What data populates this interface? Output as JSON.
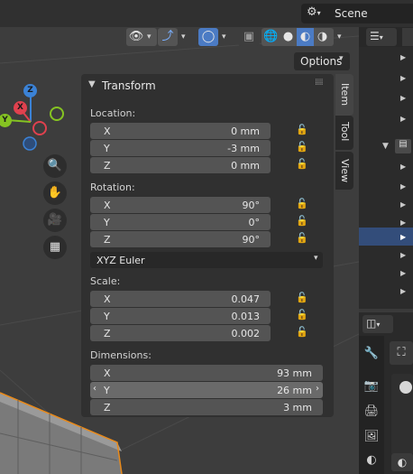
{
  "topbar": {
    "scene_label": "Scene"
  },
  "viewport": {
    "options_label": "Options",
    "gizmo": {
      "x": "X",
      "y": "Y",
      "z": "Z"
    }
  },
  "npanel": {
    "title": "Transform",
    "location": {
      "label": "Location:",
      "rows": [
        {
          "axis": "X",
          "value": "0 mm"
        },
        {
          "axis": "Y",
          "value": "-3 mm"
        },
        {
          "axis": "Z",
          "value": "0 mm"
        }
      ]
    },
    "rotation": {
      "label": "Rotation:",
      "rows": [
        {
          "axis": "X",
          "value": "90°"
        },
        {
          "axis": "Y",
          "value": "0°"
        },
        {
          "axis": "Z",
          "value": "90°"
        }
      ],
      "mode": "XYZ Euler"
    },
    "scale": {
      "label": "Scale:",
      "rows": [
        {
          "axis": "X",
          "value": "0.047"
        },
        {
          "axis": "Y",
          "value": "0.013"
        },
        {
          "axis": "Z",
          "value": "0.002"
        }
      ]
    },
    "dimensions": {
      "label": "Dimensions:",
      "rows": [
        {
          "axis": "X",
          "value": "93 mm"
        },
        {
          "axis": "Y",
          "value": "26 mm"
        },
        {
          "axis": "Z",
          "value": "3 mm"
        }
      ]
    },
    "tabs": [
      "Item",
      "Tool",
      "View"
    ]
  },
  "colors": {
    "accent": "#4b7bc4",
    "axis_x": "#e0414e",
    "axis_y": "#85c322",
    "axis_z": "#3b82d6",
    "selection_outline": "#e88a1b"
  }
}
